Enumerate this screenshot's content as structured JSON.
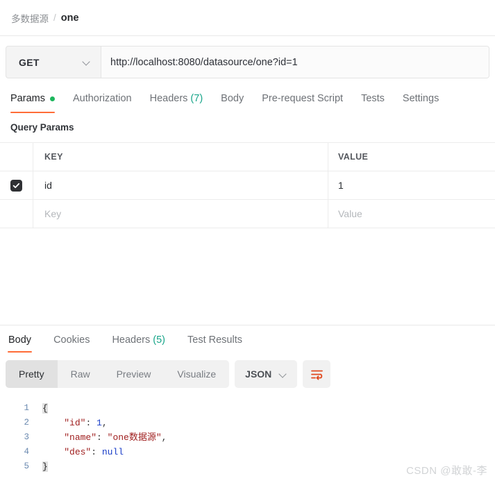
{
  "breadcrumb": {
    "parent": "多数据源",
    "separator": "/",
    "current": "one"
  },
  "request": {
    "method": "GET",
    "url": "http://localhost:8080/datasource/one?id=1",
    "tabs": [
      {
        "label": "Params",
        "badge_dot": true,
        "active": true
      },
      {
        "label": "Authorization",
        "active": false
      },
      {
        "label": "Headers",
        "count": "(7)",
        "active": false
      },
      {
        "label": "Body",
        "active": false
      },
      {
        "label": "Pre-request Script",
        "active": false
      },
      {
        "label": "Tests",
        "active": false
      },
      {
        "label": "Settings",
        "active": false
      }
    ]
  },
  "query_params": {
    "section_title": "Query Params",
    "columns": {
      "key": "KEY",
      "value": "VALUE"
    },
    "rows": [
      {
        "checked": true,
        "key": "id",
        "value": "1"
      }
    ],
    "placeholder_row": {
      "key": "Key",
      "value": "Value"
    }
  },
  "response": {
    "tabs": [
      {
        "label": "Body",
        "active": true
      },
      {
        "label": "Cookies",
        "active": false
      },
      {
        "label": "Headers",
        "count": "(5)",
        "active": false
      },
      {
        "label": "Test Results",
        "active": false
      }
    ],
    "view_modes": [
      {
        "label": "Pretty",
        "active": true
      },
      {
        "label": "Raw",
        "active": false
      },
      {
        "label": "Preview",
        "active": false
      },
      {
        "label": "Visualize",
        "active": false
      }
    ],
    "format": "JSON",
    "wrap_icon": "word-wrap-icon",
    "body": {
      "lines": [
        "1",
        "2",
        "3",
        "4",
        "5"
      ],
      "code": {
        "l1_brace": "{",
        "l2_key": "\"id\"",
        "l2_colon": ": ",
        "l2_val": "1",
        "l2_comma": ",",
        "l3_key": "\"name\"",
        "l3_colon": ": ",
        "l3_val": "\"one数据源\"",
        "l3_comma": ",",
        "l4_key": "\"des\"",
        "l4_colon": ": ",
        "l4_val": "null",
        "l5_brace": "}"
      }
    }
  },
  "watermark": "CSDN @敢敢-李",
  "colors": {
    "accent_orange": "#ff6c37",
    "status_green": "#1cb65c",
    "count_teal": "#17a589",
    "checkbox_dark": "#2f3134"
  }
}
